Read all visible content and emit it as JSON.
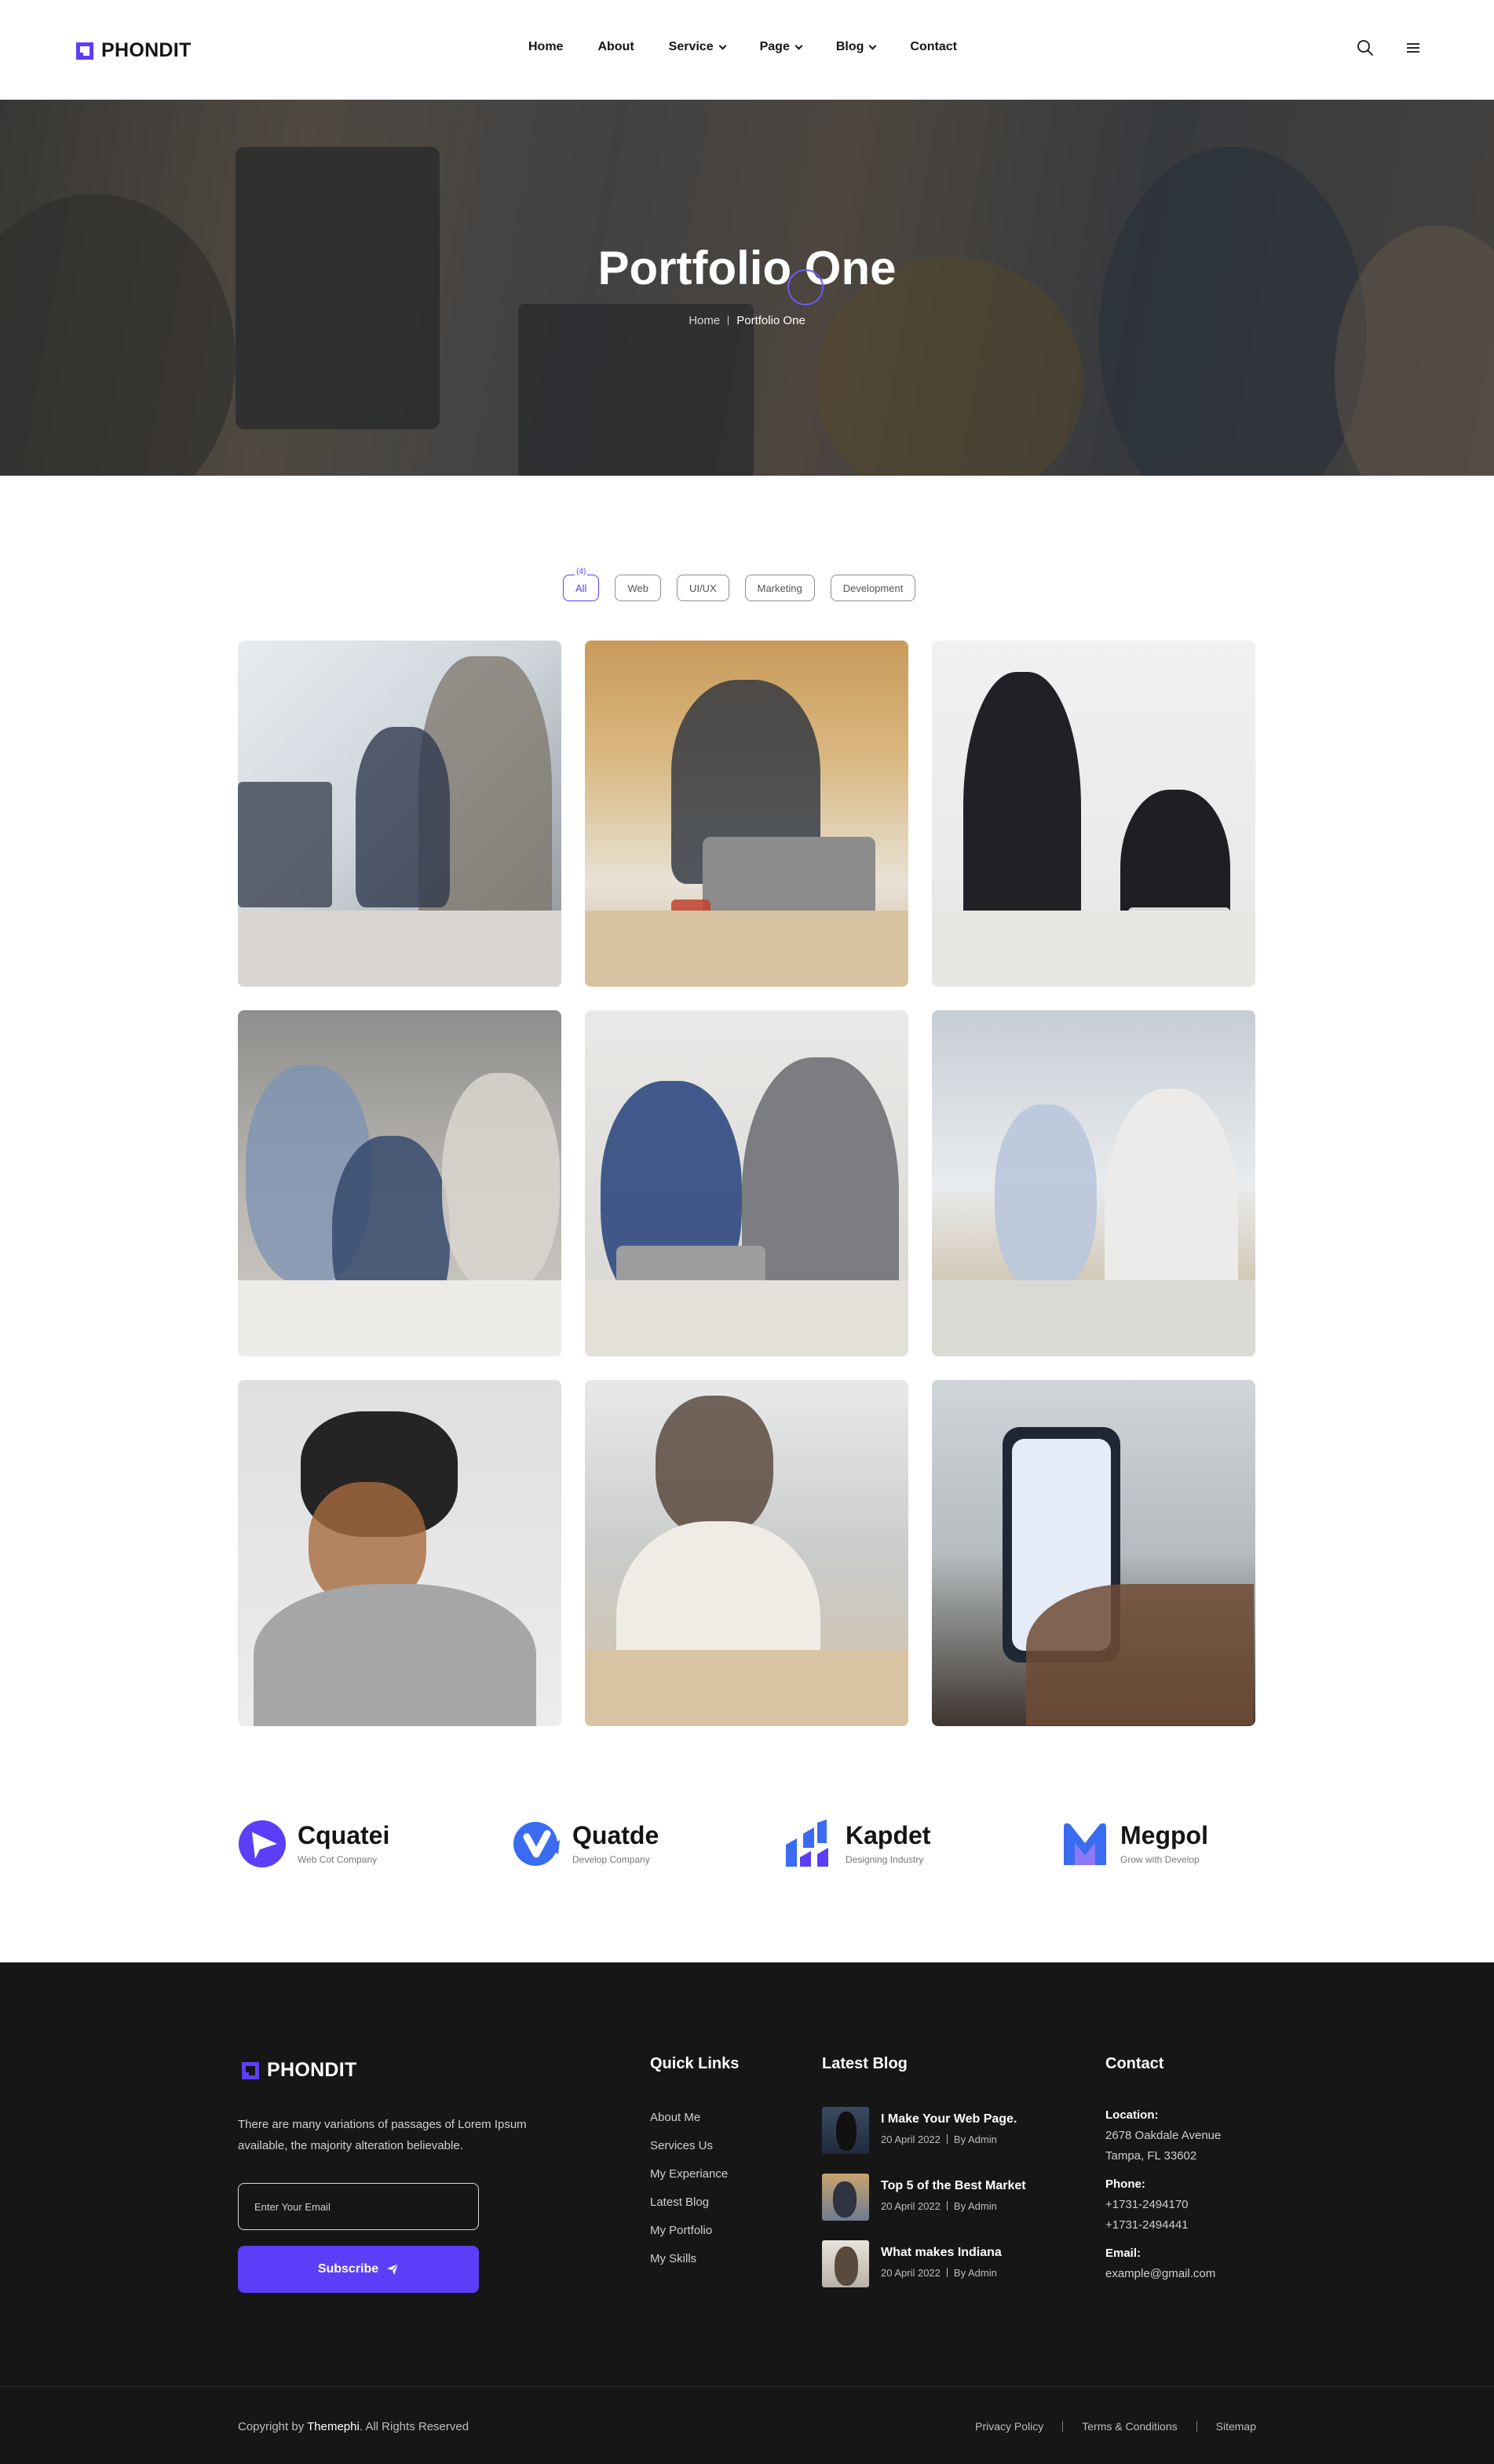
{
  "header": {
    "logo_text": "PHONDIT",
    "nav": [
      {
        "label": "Home",
        "dropdown": false
      },
      {
        "label": "About",
        "dropdown": false
      },
      {
        "label": "Service",
        "dropdown": true
      },
      {
        "label": "Page",
        "dropdown": true
      },
      {
        "label": "Blog",
        "dropdown": true
      },
      {
        "label": "Contact",
        "dropdown": false
      }
    ],
    "icons": [
      "search-icon",
      "menu-icon"
    ]
  },
  "hero": {
    "title": "Portfolio One",
    "breadcrumb": {
      "home": "Home",
      "current": "Portfolio One"
    }
  },
  "filters": {
    "items": [
      "All",
      "Web",
      "UI/UX",
      "Marketing",
      "Development"
    ],
    "active_count": "(4)"
  },
  "brands": [
    {
      "name": "Cquatei",
      "tagline": "Web Cot Company"
    },
    {
      "name": "Quatde",
      "tagline": "Develop Company"
    },
    {
      "name": "Kapdet",
      "tagline": "Designing Industry"
    },
    {
      "name": "Megpol",
      "tagline": "Grow with Develop"
    }
  ],
  "footer": {
    "logo_text": "PHONDIT",
    "description": "There are many variations of passages of Lorem Ipsum available, the majority alteration believable.",
    "email_placeholder": "Enter Your Email",
    "subscribe_label": "Subscribe",
    "quick_links_title": "Quick Links",
    "quick_links": [
      "About Me",
      "Services Us",
      "My Experiance",
      "Latest Blog",
      "My Portfolio",
      "My Skills"
    ],
    "latest_blog_title": "Latest Blog",
    "blog_posts": [
      {
        "title": "I Make Your Web Page.",
        "date": "20 April 2022",
        "author": "By Admin"
      },
      {
        "title": "Top 5 of the Best Market",
        "date": "20 April 2022",
        "author": "By Admin"
      },
      {
        "title": "What makes Indiana",
        "date": "20 April 2022",
        "author": "By Admin"
      }
    ],
    "contact_title": "Contact",
    "contact": {
      "location_label": "Location:",
      "location_line1": "2678 Oakdale Avenue",
      "location_line2": "Tampa, FL 33602",
      "phone_label": "Phone:",
      "phone1": "+1731-2494170",
      "phone2": "+1731-2494441",
      "email_label": "Email:",
      "email": "example@gmail.com"
    },
    "copyright_prefix": "Copyright by",
    "copyright_brand": "Themephi",
    "copyright_suffix": ". All Rights Reserved",
    "legal_links": [
      "Privacy Policy",
      "Terms & Conditions",
      "Sitemap"
    ]
  },
  "colors": {
    "accent": "#5b3ff8",
    "footer_bg": "#161616",
    "text_dark": "#141414"
  }
}
